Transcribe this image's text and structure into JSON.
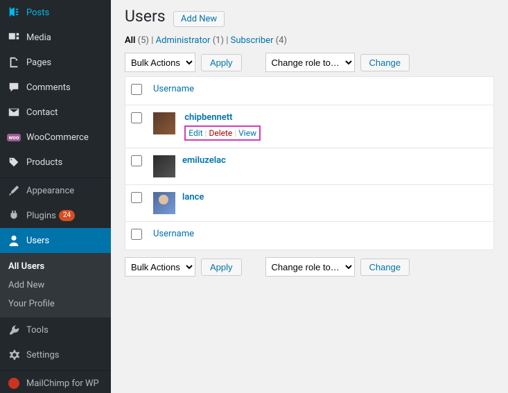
{
  "sidebar": {
    "items": [
      {
        "label": "Posts",
        "icon": "pin",
        "section": "top"
      },
      {
        "label": "Media",
        "icon": "media",
        "section": "top"
      },
      {
        "label": "Pages",
        "icon": "page",
        "section": "top"
      },
      {
        "label": "Comments",
        "icon": "comment",
        "section": "top"
      },
      {
        "label": "Contact",
        "icon": "contact",
        "section": "top"
      },
      {
        "label": "WooCommerce",
        "icon": "woo",
        "section": "top"
      },
      {
        "label": "Products",
        "icon": "product",
        "section": "top"
      },
      {
        "label": "Appearance",
        "icon": "brush",
        "section": "bottom"
      },
      {
        "label": "Plugins",
        "icon": "plugin",
        "section": "bottom",
        "badge": "24"
      },
      {
        "label": "Users",
        "icon": "user",
        "section": "bottom",
        "current": true
      },
      {
        "label": "Tools",
        "icon": "tools",
        "section": "bottom2"
      },
      {
        "label": "Settings",
        "icon": "settings",
        "section": "bottom2"
      },
      {
        "label": "MailChimp for WP",
        "icon": "mailchimp",
        "section": "bottom3"
      }
    ],
    "submenu": [
      {
        "label": "All Users",
        "current": true
      },
      {
        "label": "Add New"
      },
      {
        "label": "Your Profile"
      }
    ]
  },
  "page": {
    "title": "Users",
    "add_new": "Add New"
  },
  "filters": {
    "all_label": "All",
    "all_count": "(5)",
    "admin_label": "Administrator",
    "admin_count": "(1)",
    "sub_label": "Subscriber",
    "sub_count": "(4)",
    "sep": " | "
  },
  "tablenav": {
    "bulk_label": "Bulk Actions",
    "apply": "Apply",
    "role_label": "Change role to…",
    "change": "Change"
  },
  "table": {
    "col_username": "Username",
    "rows": [
      {
        "username": "chipbennett",
        "avatar": "av1",
        "actions": true
      },
      {
        "username": "emiluzelac",
        "avatar": "av2"
      },
      {
        "username": "lance",
        "avatar": "av3"
      }
    ],
    "actions": {
      "edit": "Edit",
      "delete": "Delete",
      "view": "View",
      "sep": " | "
    }
  }
}
